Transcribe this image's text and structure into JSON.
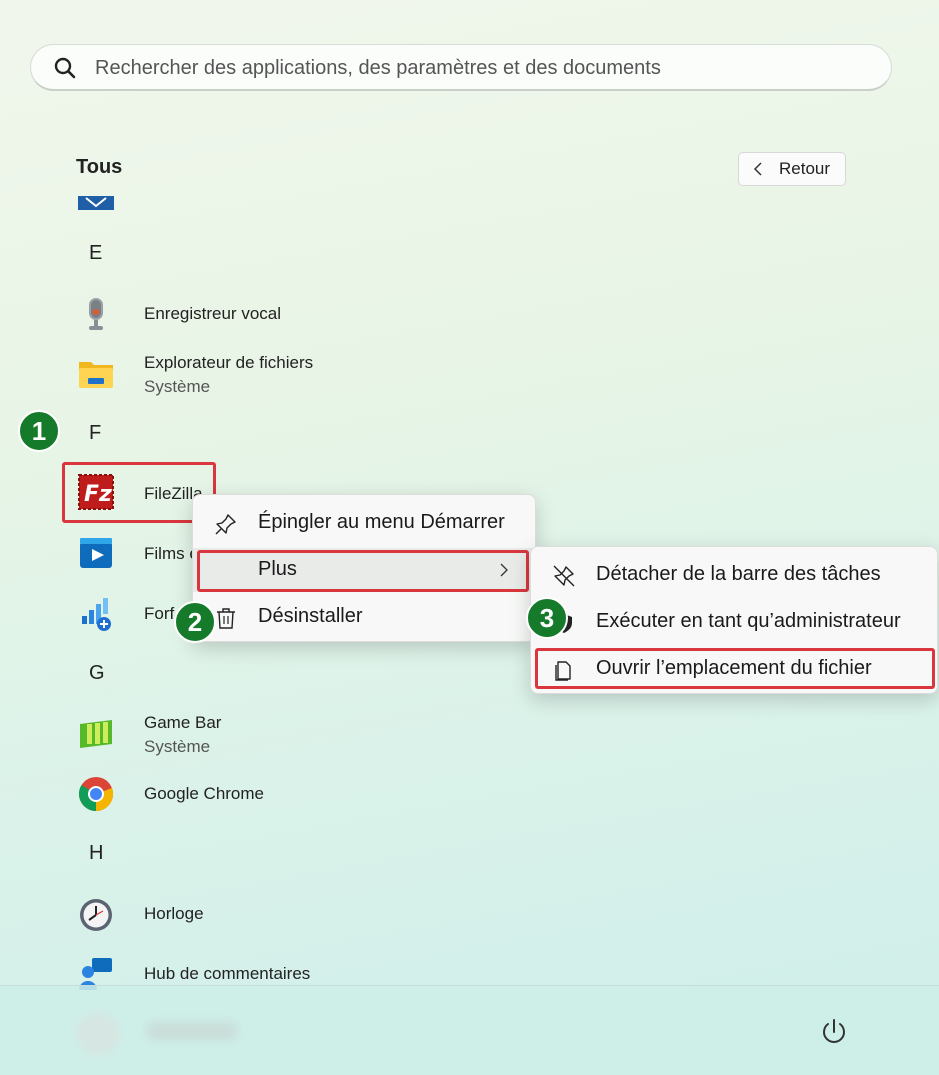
{
  "search": {
    "placeholder": "Rechercher des applications, des paramètres et des documents"
  },
  "header": {
    "title": "Tous",
    "back_label": "Retour"
  },
  "letters": {
    "e": "E",
    "f": "F",
    "g": "G",
    "h": "H"
  },
  "apps": {
    "enregistreur": {
      "name": "Enregistreur vocal"
    },
    "explorateur": {
      "name": "Explorateur de fichiers",
      "sub": "Système"
    },
    "filezilla": {
      "name": "FileZilla"
    },
    "films": {
      "name": "Films e"
    },
    "forfait": {
      "name": "Forf"
    },
    "gamebar": {
      "name": "Game Bar",
      "sub": "Système"
    },
    "chrome": {
      "name": "Google Chrome"
    },
    "horloge": {
      "name": "Horloge"
    },
    "hub": {
      "name": "Hub de commentaires"
    }
  },
  "context_menu": {
    "pin": "Épingler au menu Démarrer",
    "more": "Plus",
    "uninstall": "Désinstaller"
  },
  "submenu": {
    "unpin_taskbar": "Détacher de la barre des tâches",
    "run_admin": "Exécuter en tant qu’administrateur",
    "open_location": "Ouvrir l’emplacement du fichier"
  },
  "badges": {
    "one": "1",
    "two": "2",
    "three": "3"
  },
  "colors": {
    "highlight": "#d9363e",
    "badge": "#157a2a"
  }
}
